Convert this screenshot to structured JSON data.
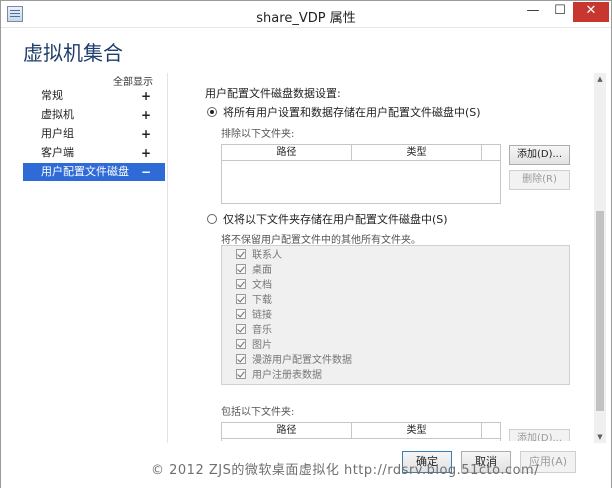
{
  "window": {
    "title": "share_VDP 属性",
    "min_symbol": "—",
    "max_symbol": "☐",
    "close_symbol": "✕",
    "app_icon": "properties-window-icon"
  },
  "page_title": "虚拟机集合",
  "sidebar": {
    "show_all": "全部显示",
    "items": [
      {
        "label": "常规",
        "expander": "+",
        "selected": false
      },
      {
        "label": "虚拟机",
        "expander": "+",
        "selected": false
      },
      {
        "label": "用户组",
        "expander": "+",
        "selected": false
      },
      {
        "label": "客户端",
        "expander": "+",
        "selected": false
      },
      {
        "label": "用户配置文件磁盘",
        "expander": "−",
        "selected": true
      }
    ]
  },
  "content": {
    "section_title": "用户配置文件磁盘数据设置:",
    "option_all": {
      "label": "将所有用户设置和数据存储在用户配置文件磁盘中(S)",
      "selected": true
    },
    "exclude_label": "排除以下文件夹:",
    "exclude_table": {
      "columns": [
        "路径",
        "类型"
      ]
    },
    "add_button": "添加(D)...",
    "remove_button": "删除(R)",
    "option_only": {
      "label": "仅将以下文件夹存储在用户配置文件磁盘中(S)",
      "selected": false
    },
    "only_note": "将不保留用户配置文件中的其他所有文件夹。",
    "folders": [
      {
        "label": "联系人",
        "checked": true
      },
      {
        "label": "桌面",
        "checked": true
      },
      {
        "label": "文档",
        "checked": true
      },
      {
        "label": "下载",
        "checked": true
      },
      {
        "label": "链接",
        "checked": true
      },
      {
        "label": "音乐",
        "checked": true
      },
      {
        "label": "图片",
        "checked": true
      },
      {
        "label": "漫游用户配置文件数据",
        "checked": true
      },
      {
        "label": "用户注册表数据",
        "checked": true
      }
    ],
    "include_label": "包括以下文件夹:",
    "include_table": {
      "columns": [
        "路径",
        "类型"
      ]
    },
    "add_button_2": "添加(D)..."
  },
  "footer": {
    "ok": "确定",
    "cancel": "取消",
    "apply": "应用(A)"
  },
  "watermark": "© 2012 ZJS的微软桌面虚拟化 http://rdsrv.blog.51cto.com/",
  "scrollbar": {
    "up_symbol": "▲",
    "down_symbol": "▼"
  }
}
